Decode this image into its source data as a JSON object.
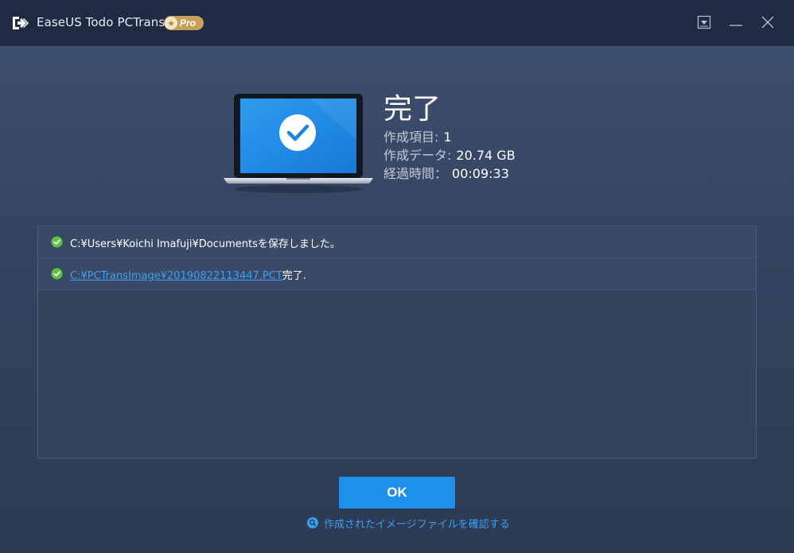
{
  "window": {
    "app_name": "EaseUS Todo PCTrans",
    "badge": "Pro",
    "controls": [
      "menu-dropdown",
      "minimize",
      "close"
    ]
  },
  "summary": {
    "title": "完了",
    "items_label": "作成項目:",
    "items_value": "1",
    "data_label": "作成データ:",
    "data_value": "20.74 GB",
    "time_label": "経過時間：",
    "time_value": "00:09:33"
  },
  "log": {
    "rows": [
      {
        "status": "success",
        "text": "C:¥Users¥Koichi Imafuji¥Documentsを保存しました。"
      },
      {
        "status": "success",
        "link": "C:¥PCTransImage¥20190822113447.PCT",
        "suffix": "完了."
      }
    ]
  },
  "actions": {
    "ok_label": "OK",
    "confirm_link_label": "作成されたイメージファイルを確認する"
  },
  "colors": {
    "accent": "#1e90ec",
    "link": "#3aa0f2",
    "success": "#5cc13b",
    "titlebar": "#1f2b42",
    "background": "#3a4a67"
  },
  "icons": [
    "app-logo-icon",
    "star-icon",
    "dropdown-icon",
    "minimize-icon",
    "close-icon",
    "laptop-check-icon",
    "check-circle-icon",
    "search-icon"
  ]
}
